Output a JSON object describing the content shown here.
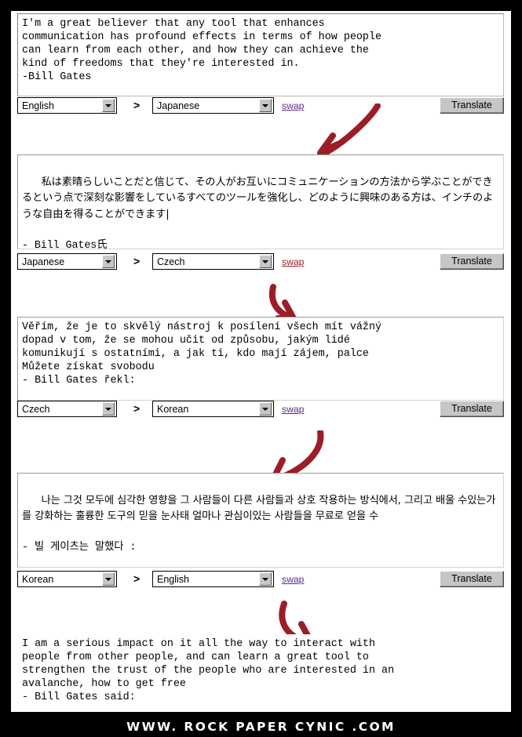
{
  "frame": {
    "watermark": "WWW. ROCK PAPER CYNIC .COM",
    "background_color": "#000000",
    "page_color": "#ffffff"
  },
  "ui": {
    "separator": ">",
    "swap_label": "swap",
    "translate_label": "Translate",
    "link_color": "#5b2a8c",
    "arrow_color": "#9b1d28",
    "button_face_color": "#c6c6c6"
  },
  "steps": [
    {
      "text": "I'm a great believer that any tool that enhances\ncommunication has profound effects in terms of how people\ncan learn from each other, and how they can achieve the\nkind of freedoms that they're interested in.\n-Bill Gates",
      "source_language": "English",
      "target_language": "Japanese"
    },
    {
      "text": "私は素晴らしいことだと信じて、その人がお互いにコミュニケーションの方法から学ぶことができるという点で深刻な影響をしているすべてのツールを強化し、どのように興味のある方は、インチのような自由を得ることができます|",
      "text_tail": "- Bill Gates氏",
      "source_language": "Japanese",
      "target_language": "Czech"
    },
    {
      "text": "Věřím, že je to skvělý nástroj k posílení všech mít vážný\ndopad v tom, že se mohou učit od způsobu, jakým lidé\nkomunikují s ostatními, a jak ti, kdo mají zájem, palce\nMůžete získat svobodu\n- Bill Gates řekl:",
      "source_language": "Czech",
      "target_language": "Korean"
    },
    {
      "text": "나는 그것 모두에 심각한 영향을 그 사람들이 다른 사람들과 상호 작용하는 방식에서, 그리고 배울 수있는가를 강화하는 훌륭한 도구의 믿을 눈사태 얼마나 관심이있는 사람들을 무료로 얻을 수",
      "text_tail": "- 빌 게이츠는 말했다 :",
      "source_language": "Korean",
      "target_language": "English"
    },
    {
      "text": "I am a serious impact on it all the way to interact with\npeople from other people, and can learn a great tool to\nstrengthen the trust of the people who are interested in an\navalanche, how to get free\n- Bill Gates said:"
    }
  ]
}
